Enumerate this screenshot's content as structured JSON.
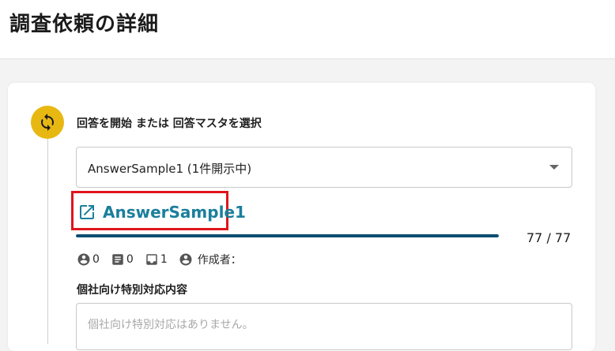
{
  "page": {
    "title": "調査依頼の詳細"
  },
  "step": {
    "icon": "sync-icon",
    "label": "回答を開始 または 回答マスタを選択"
  },
  "answer_select": {
    "selected_value": "AnswerSample1 (1件開示中)"
  },
  "answer_link": {
    "icon": "open-in-new-icon",
    "label": "AnswerSample1"
  },
  "progress": {
    "completed": 77,
    "total": 77,
    "count_label": "77 / 77"
  },
  "stats": {
    "account_count": "0",
    "document_count": "0",
    "inbox_count": "1",
    "author_label": "作成者："
  },
  "custom_section": {
    "label": "個社向け特別対応内容",
    "placeholder": "個社向け特別対応はありません。"
  },
  "colors": {
    "accent": "#1b7f9c",
    "progress": "#0e4d72",
    "step_icon_bg": "#e8b812",
    "highlight": "#e0151b"
  }
}
